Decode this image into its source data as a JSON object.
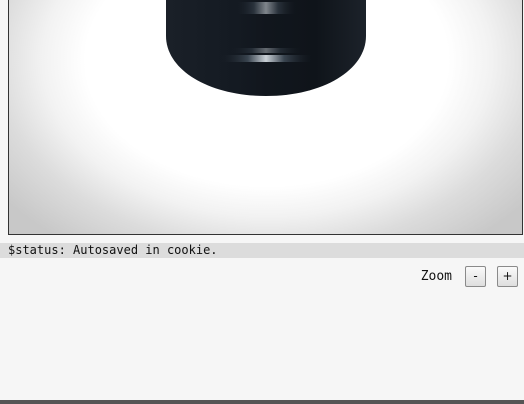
{
  "viewport": {
    "object": "dark-dome-shape"
  },
  "status": {
    "text": "$status: Autosaved in cookie."
  },
  "zoom": {
    "label": "Zoom",
    "minus_label": "-",
    "plus_label": "+"
  }
}
